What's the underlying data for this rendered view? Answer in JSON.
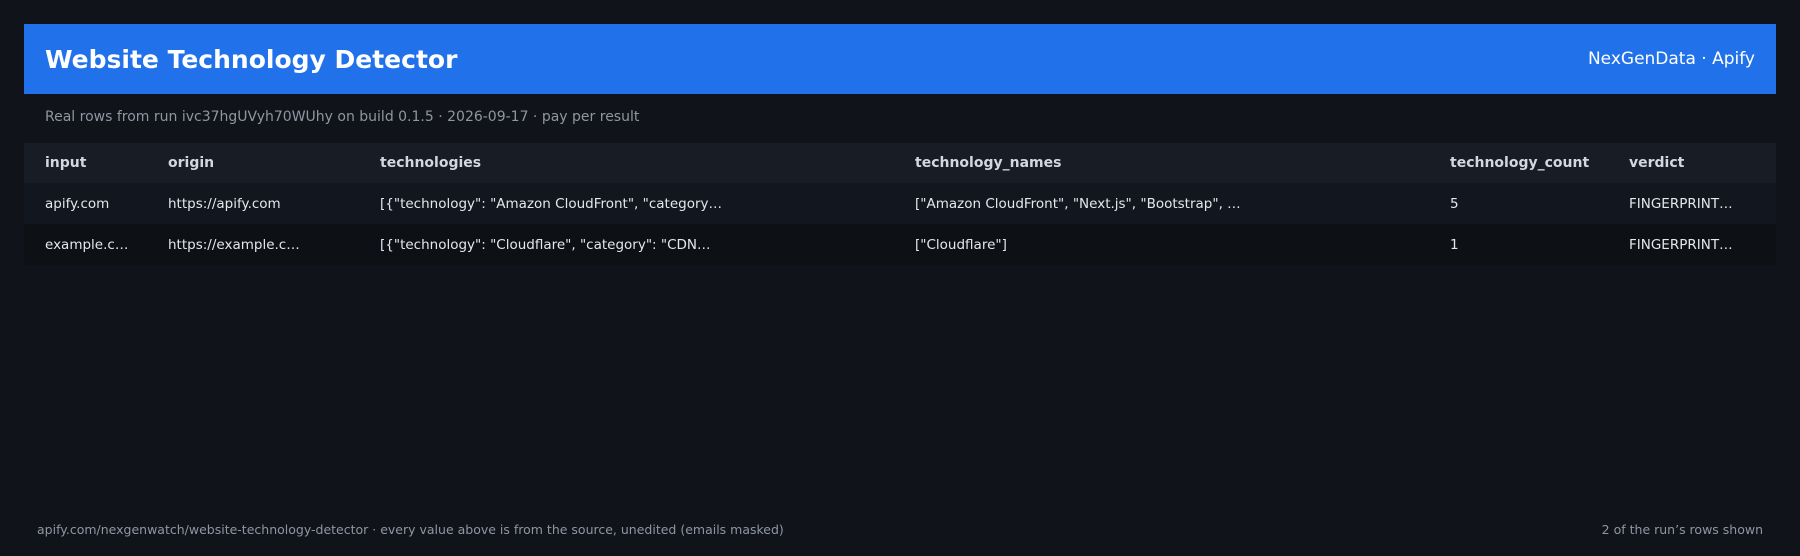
{
  "header": {
    "title": "Website Technology Detector",
    "brand": "NexGenData · Apify"
  },
  "subtitle": "Real rows from run ivc37hgUVyh70WUhy on build 0.1.5 · 2026-09-17 · pay per result",
  "table": {
    "columns": [
      "input",
      "origin",
      "technologies",
      "technology_names",
      "technology_count",
      "verdict"
    ],
    "rows": [
      [
        "apify.com",
        "https://apify.com",
        "[{\"technology\": \"Amazon CloudFront\", \"category…",
        "[\"Amazon CloudFront\", \"Next.js\", \"Bootstrap\", …",
        "5",
        "FINGERPRINT…"
      ],
      [
        "example.c…",
        "https://example.c…",
        "[{\"technology\": \"Cloudflare\", \"category\": \"CDN…",
        "[\"Cloudflare\"]",
        "1",
        "FINGERPRINT…"
      ]
    ]
  },
  "footer": {
    "left": "apify.com/nexgenwatch/website-technology-detector  ·  every value above is from the source, unedited (emails masked)",
    "right": "2 of the run’s rows shown"
  },
  "colors": {
    "background": "#10131a",
    "header": "#2172ea",
    "table_header": "#171c25",
    "row_odd": "#12161e",
    "row_even": "#0d1015",
    "muted_text": "#8f96a2"
  }
}
